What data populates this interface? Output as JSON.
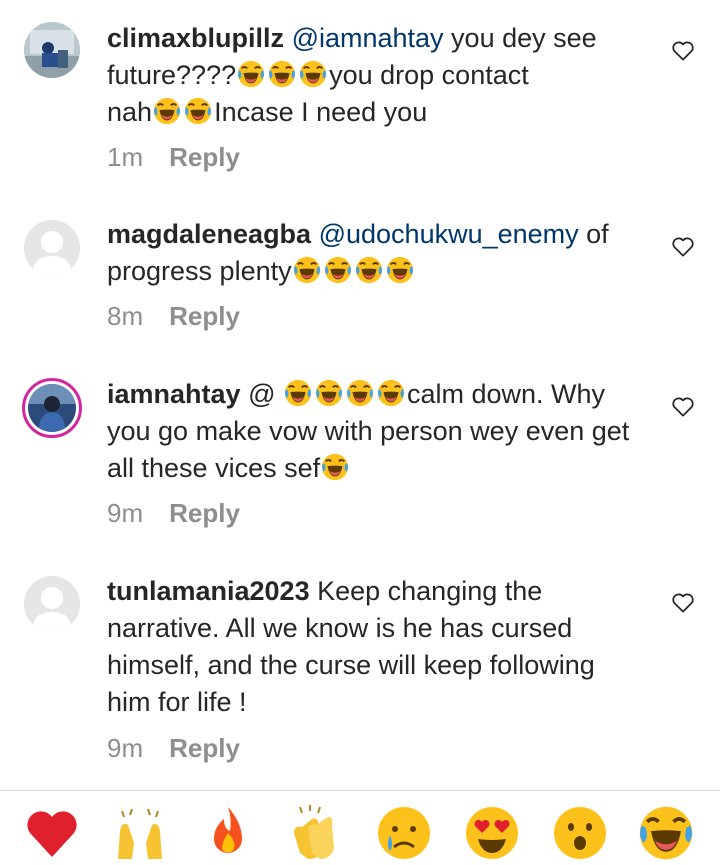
{
  "comments": [
    {
      "username": "climaxblupillz",
      "mention": "@iamnahtay",
      "line1_text": " you dey see",
      "line2_text_a": "future????",
      "line2_text_b": "you drop contact",
      "line3_text_a": "nah",
      "line3_text_b": "Incase I need you",
      "time": "1m",
      "reply_label": "Reply"
    },
    {
      "username": "magdaleneagba",
      "mention": "@udochukwu_enemy",
      "line1_text": " of",
      "line2_text": "progress plenty",
      "time": "8m",
      "reply_label": "Reply"
    },
    {
      "username": "iamnahtay",
      "line1_text": " @ ",
      "line1_text_b": "calm down. Why",
      "line2_text": "you go make vow with person wey even get",
      "line3_text": "all these vices sef",
      "time": "9m",
      "reply_label": "Reply"
    },
    {
      "username": "tunlamania2023",
      "line1_text": " Keep changing the",
      "line2_text": "narrative. All we know is he has cursed",
      "line3_text": "himself, and the curse will keep following",
      "line4_text": "him for life !",
      "time": "9m",
      "reply_label": "Reply"
    }
  ],
  "icons": {
    "like": "heart-outline-icon",
    "laugh": "face-with-tears-of-joy-icon"
  },
  "quick_reactions": [
    "red-heart-icon",
    "raising-hands-icon",
    "fire-icon",
    "clapping-hands-icon",
    "crying-face-icon",
    "heart-eyes-icon",
    "astonished-face-icon",
    "face-with-tears-of-joy-icon"
  ],
  "colors": {
    "mention": "#00376b",
    "meta": "#8e8e8e",
    "text": "#262626",
    "story_ring": "#d6249f"
  }
}
